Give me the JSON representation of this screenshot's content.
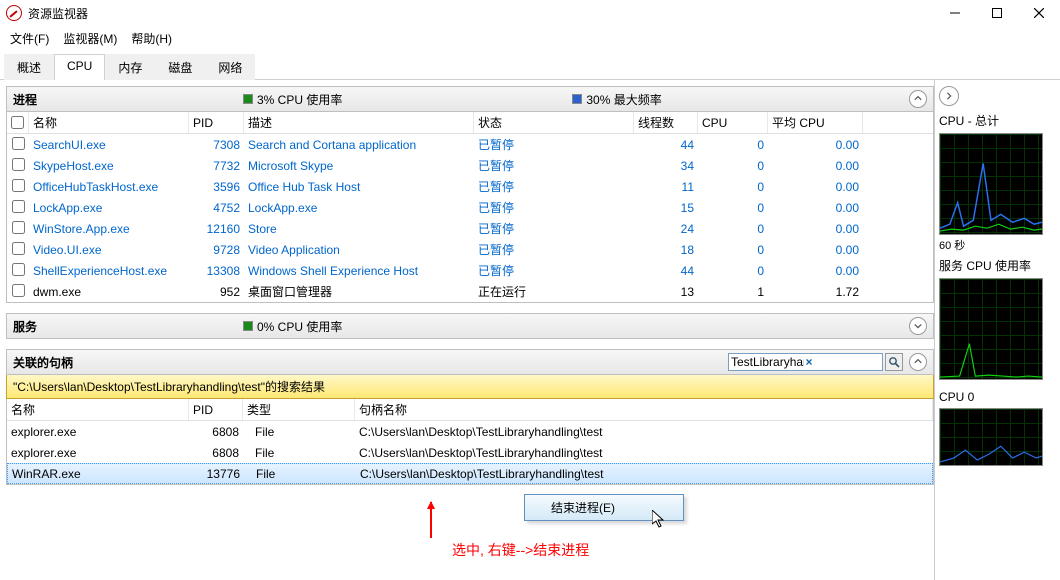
{
  "window": {
    "title": "资源监视器"
  },
  "menu": {
    "file": "文件(F)",
    "monitor": "监视器(M)",
    "help": "帮助(H)"
  },
  "tabs": {
    "overview": "概述",
    "cpu": "CPU",
    "memory": "内存",
    "disk": "磁盘",
    "network": "网络"
  },
  "processes": {
    "title": "进程",
    "stat1": "3% CPU 使用率",
    "stat2": "30% 最大频率",
    "columns": {
      "name": "名称",
      "pid": "PID",
      "desc": "描述",
      "status": "状态",
      "threads": "线程数",
      "cpu": "CPU",
      "avg": "平均 CPU"
    },
    "rows": [
      {
        "name": "SearchUI.exe",
        "pid": "7308",
        "desc": "Search and Cortana application",
        "status": "已暂停",
        "threads": "44",
        "cpu": "0",
        "avg": "0.00",
        "link": true
      },
      {
        "name": "SkypeHost.exe",
        "pid": "7732",
        "desc": "Microsoft Skype",
        "status": "已暂停",
        "threads": "34",
        "cpu": "0",
        "avg": "0.00",
        "link": true
      },
      {
        "name": "OfficeHubTaskHost.exe",
        "pid": "3596",
        "desc": "Office Hub Task Host",
        "status": "已暂停",
        "threads": "11",
        "cpu": "0",
        "avg": "0.00",
        "link": true
      },
      {
        "name": "LockApp.exe",
        "pid": "4752",
        "desc": "LockApp.exe",
        "status": "已暂停",
        "threads": "15",
        "cpu": "0",
        "avg": "0.00",
        "link": true
      },
      {
        "name": "WinStore.App.exe",
        "pid": "12160",
        "desc": "Store",
        "status": "已暂停",
        "threads": "24",
        "cpu": "0",
        "avg": "0.00",
        "link": true
      },
      {
        "name": "Video.UI.exe",
        "pid": "9728",
        "desc": "Video Application",
        "status": "已暂停",
        "threads": "18",
        "cpu": "0",
        "avg": "0.00",
        "link": true
      },
      {
        "name": "ShellExperienceHost.exe",
        "pid": "13308",
        "desc": "Windows Shell Experience Host",
        "status": "已暂停",
        "threads": "44",
        "cpu": "0",
        "avg": "0.00",
        "link": true
      },
      {
        "name": "dwm.exe",
        "pid": "952",
        "desc": "桌面窗口管理器",
        "status": "正在运行",
        "threads": "13",
        "cpu": "1",
        "avg": "1.72",
        "link": false
      }
    ]
  },
  "services": {
    "title": "服务",
    "stat1": "0% CPU 使用率"
  },
  "handles": {
    "title": "关联的句柄",
    "search_value": "TestLibraryhandling\\test",
    "search_banner": "\"C:\\Users\\lan\\Desktop\\TestLibraryhandling\\test\"的搜索结果",
    "columns": {
      "name": "名称",
      "pid": "PID",
      "type": "类型",
      "handle": "句柄名称"
    },
    "rows": [
      {
        "name": "explorer.exe",
        "pid": "6808",
        "type": "File",
        "handle": "C:\\Users\\lan\\Desktop\\TestLibraryhandling\\test"
      },
      {
        "name": "explorer.exe",
        "pid": "6808",
        "type": "File",
        "handle": "C:\\Users\\lan\\Desktop\\TestLibraryhandling\\test"
      },
      {
        "name": "WinRAR.exe",
        "pid": "13776",
        "type": "File",
        "handle": "C:\\Users\\lan\\Desktop\\TestLibraryhandling\\test"
      }
    ]
  },
  "context_menu": {
    "end_process": "结束进程(E)"
  },
  "annotation": {
    "text": "选中, 右键-->结束进程"
  },
  "right": {
    "g1_title": "CPU - 总计",
    "g1_sub": "60 秒",
    "g2_title": "服务 CPU 使用率",
    "g3_title": "CPU 0"
  }
}
